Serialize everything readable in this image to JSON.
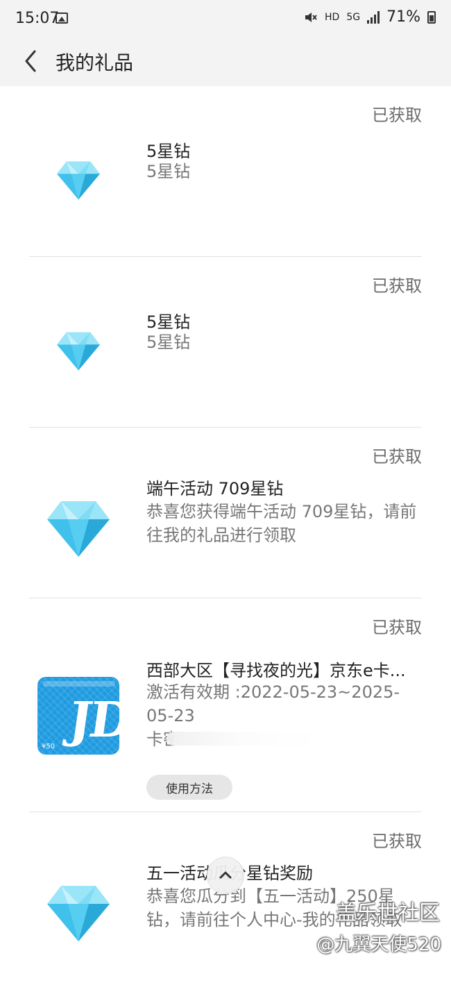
{
  "status_bar": {
    "time": "15:07",
    "network": "HD",
    "network_type": "5G",
    "battery_percent": "71%"
  },
  "header": {
    "title": "我的礼品"
  },
  "gifts": [
    {
      "status": "已获取",
      "name": "5星钻",
      "desc": "5星钻"
    },
    {
      "status": "已获取",
      "name": "5星钻",
      "desc": "5星钻"
    },
    {
      "status": "已获取",
      "name": "端午活动 709星钻",
      "desc": "恭喜您获得端午活动 709星钻，请前往我的礼品进行领取"
    },
    {
      "status": "已获取",
      "name": "西部大区【寻找夜的光】京东e卡...",
      "desc": "激活有效期 :2022-05-23~2025-05-23",
      "card_label": "卡密",
      "card_logo": "JD",
      "card_value": "¥50",
      "usage_button": "使用方法"
    },
    {
      "status": "已获取",
      "name": "五一活动瓜分星钻奖励",
      "desc": "恭喜您瓜分到【五一活动】250星钻，请前往个人中心-我的礼品领取"
    }
  ],
  "watermark": {
    "line1": "盖乐世社区",
    "line2": "@九翼天使520"
  },
  "colors": {
    "diamond_light": "#7fdcf5",
    "diamond_mid": "#3fc1ec",
    "diamond_dark": "#2aa9d9",
    "jd_card_blue": "#1f9be0"
  }
}
